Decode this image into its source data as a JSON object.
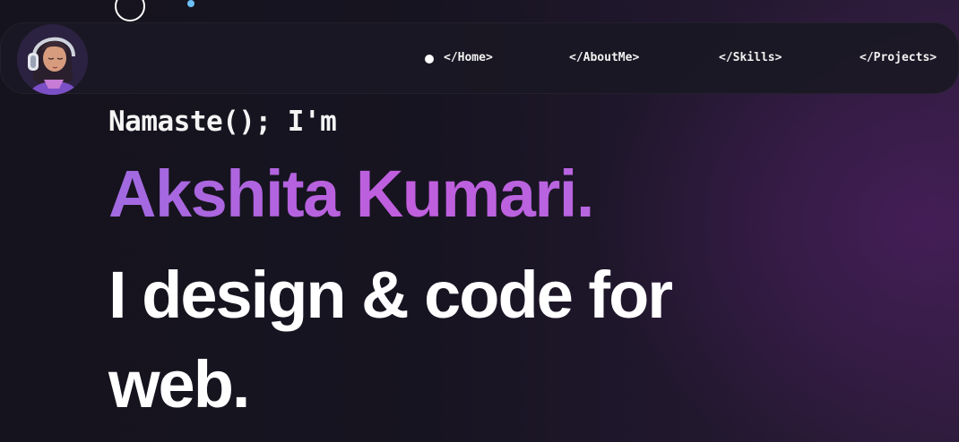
{
  "nav": {
    "items": [
      {
        "label": "</Home>",
        "active": true
      },
      {
        "label": "</AboutMe>"
      },
      {
        "label": "</Skills>"
      },
      {
        "label": "</Projects>"
      }
    ]
  },
  "hero": {
    "greeting": "Namaste(); I'm",
    "name": "Akshita Kumari.",
    "tagline_line1": "I design & code for",
    "tagline_line2": "web."
  },
  "colors": {
    "background": "#16141e",
    "accent_name_start": "#a06ae0",
    "accent_name_end": "#c05ede",
    "deco_dot": "#6cc0f5"
  },
  "icons": [
    "avatar-headphones-illustration",
    "active-nav-dot",
    "decorative-ring"
  ]
}
